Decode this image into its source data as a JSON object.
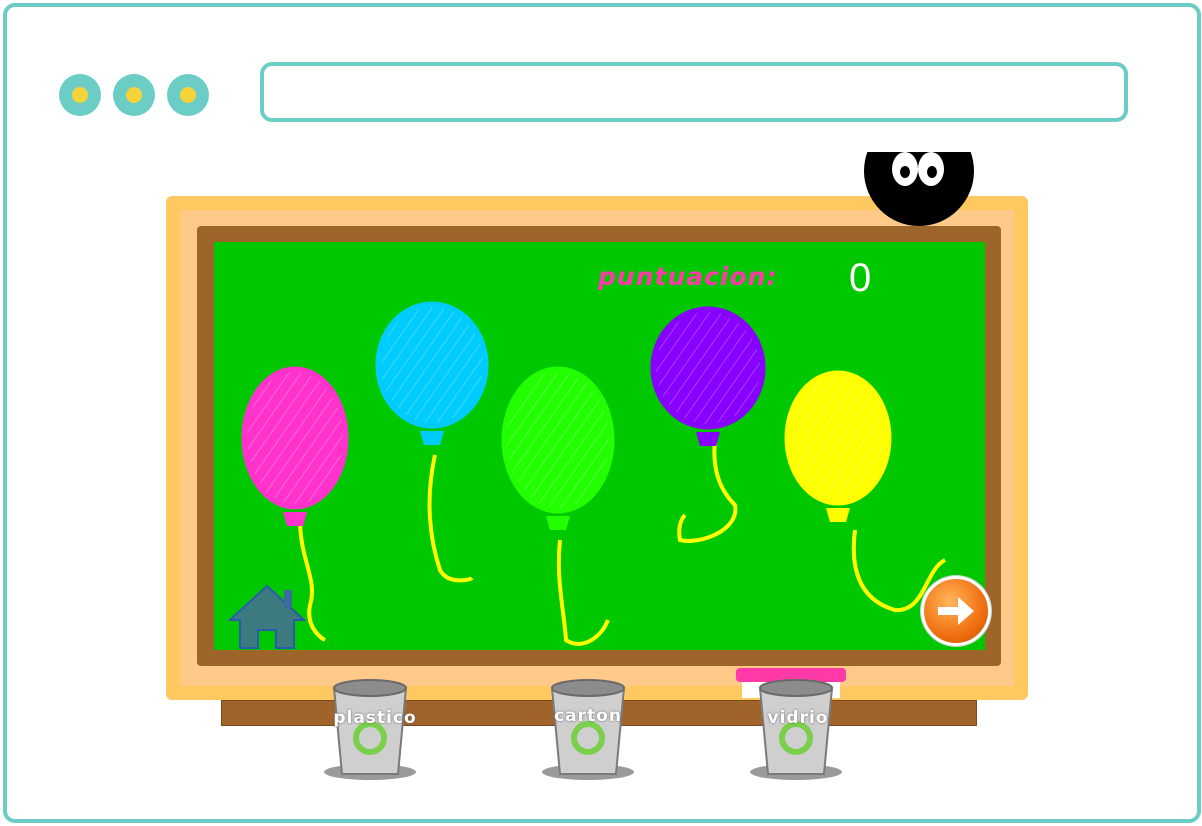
{
  "browser": {
    "window_dots": [
      "dot-1",
      "dot-2",
      "dot-3"
    ],
    "address_bar_value": ""
  },
  "game": {
    "score": {
      "label": "puntuacion:",
      "value": "0"
    },
    "balloons": [
      {
        "color_name": "pink",
        "color": "#ff33cc"
      },
      {
        "color_name": "blue",
        "color": "#00ccff"
      },
      {
        "color_name": "green",
        "color": "#22ff00"
      },
      {
        "color_name": "purple",
        "color": "#8800ff"
      },
      {
        "color_name": "yellow",
        "color": "#ffff00"
      }
    ],
    "bins": [
      {
        "label": "plastico"
      },
      {
        "label": "carton"
      },
      {
        "label": "vidrio"
      }
    ],
    "controls": {
      "home_icon": "house-icon",
      "next_icon": "arrow-right-icon"
    },
    "colors": {
      "chalkboard": "#00c800",
      "board_wood": "#9d6529",
      "board_frame": "#ffc960",
      "score_label": "#ff3aa8",
      "accent": "#6ccdc6"
    }
  }
}
